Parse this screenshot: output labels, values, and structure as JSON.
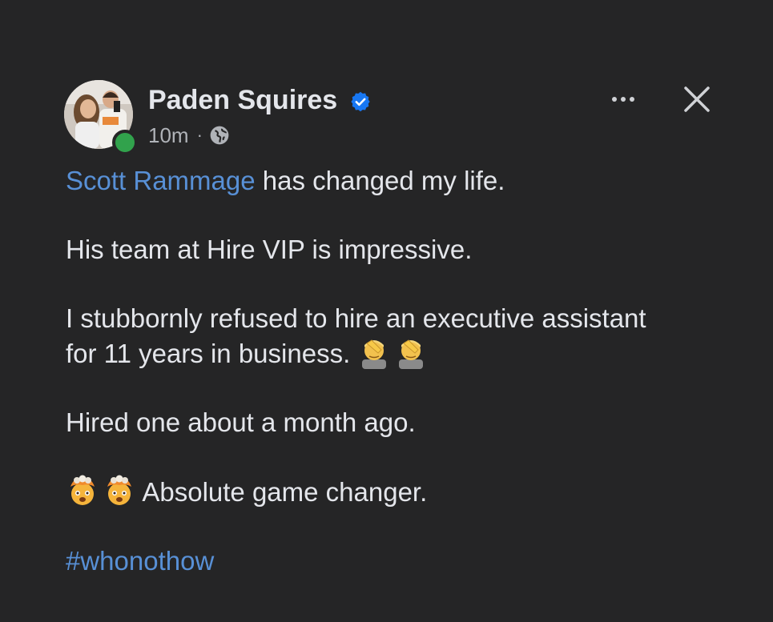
{
  "post": {
    "author": "Paden Squires",
    "time": "10m",
    "separator": "·",
    "audience_icon": "globe-icon",
    "verified_icon": "verified-badge-icon",
    "menu_icon": "more-horizontal-icon",
    "close_icon": "close-icon",
    "mention": "Scott Rammage",
    "line1_rest": " has changed my life.",
    "line2": "His team at Hire VIP is impressive.",
    "line3a": "I stubbornly refused to hire an executive assistant",
    "line3b": "for 11 years in business.",
    "line3_emoji": "facepalm-emoji",
    "line4": "Hired one about a month ago.",
    "line5_emoji": "exploding-head-emoji",
    "line5": "Absolute game changer.",
    "hashtag": "#whonothow"
  },
  "colors": {
    "background": "#252526",
    "text": "#e4e6eb",
    "secondary_text": "#b0b3b8",
    "link": "#5890d6",
    "verified": "#1877f2",
    "online": "#31a24c"
  }
}
